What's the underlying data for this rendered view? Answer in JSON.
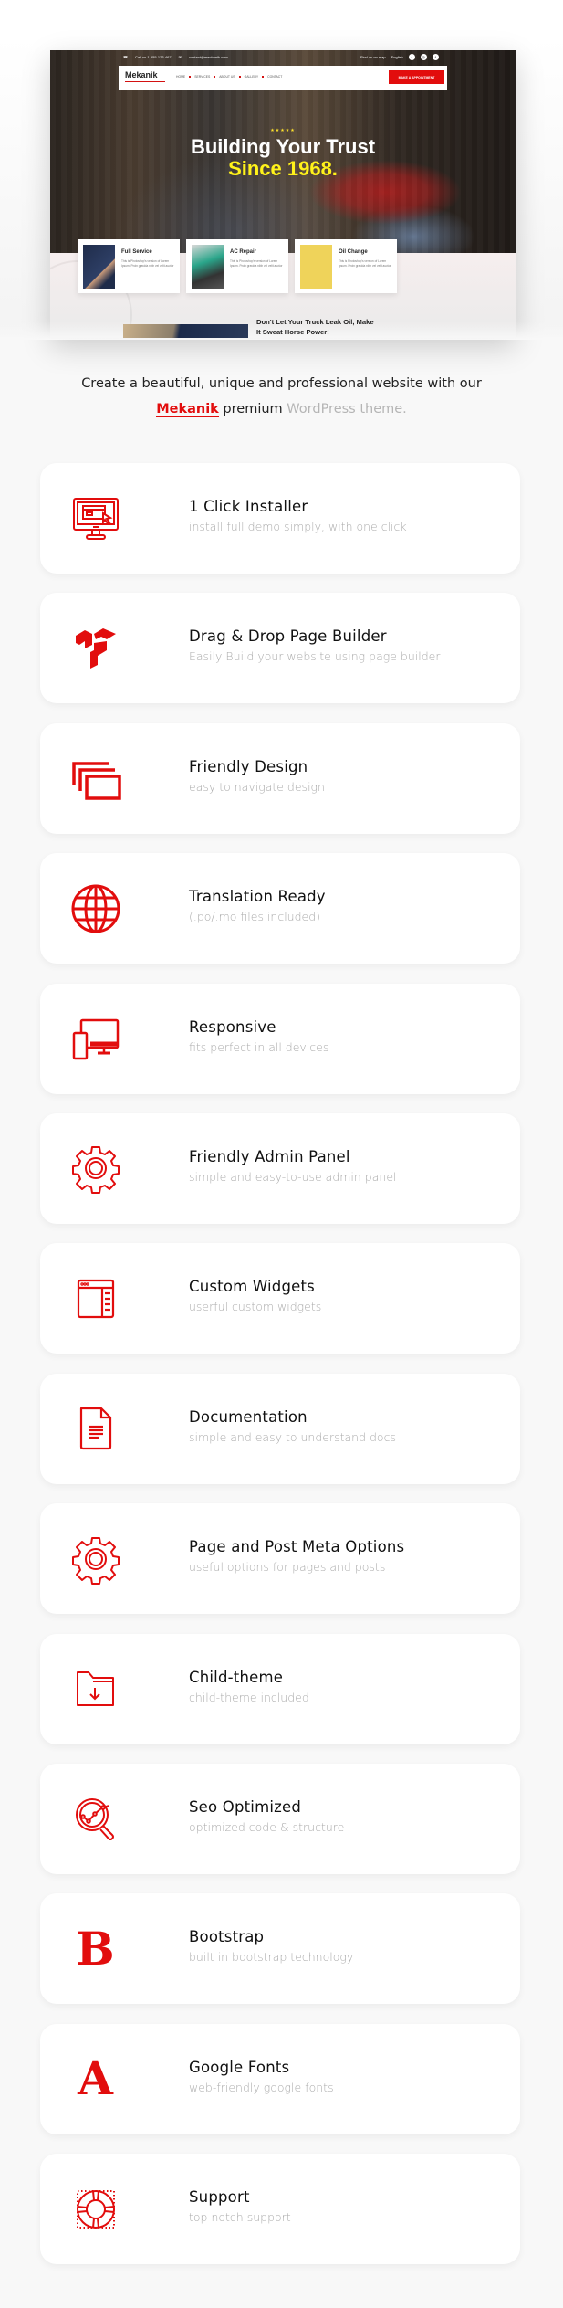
{
  "hero": {
    "topbar": {
      "phone": "Call us 1-555-123-467",
      "email": "contact@mechanik.com",
      "map_link": "Find us on map",
      "language": "English",
      "social": [
        "twitter-icon",
        "dribbble-icon",
        "facebook-icon"
      ]
    },
    "navbar": {
      "logo": "Mekanik",
      "links": [
        "HOME",
        "SERVICES",
        "ABOUT US",
        "GALLERY",
        "CONTACT"
      ],
      "cta": "MAKE A APPOINTMENT"
    },
    "stars": "★★★★★",
    "title": "Building Your Trust",
    "subtitle": "Since 1968.",
    "services": [
      {
        "title": "Full Service",
        "text": "This is Photoshop's version of Lorem Ipsum. Proin gravida nibh vel velit auctor"
      },
      {
        "title": "AC Repair",
        "text": "This is Photoshop's version of Lorem Ipsum. Proin gravida nibh vel velit auctor"
      },
      {
        "title": "Oil Change",
        "text": "This is Photoshop's version of Lorem Ipsum. Proin gravida nibh vel velit auctor"
      }
    ],
    "post_title": "Don't Let Your Truck Leak Oil, Make It Sweat Horse Power!"
  },
  "intro": {
    "line1": "Create a beautiful, unique and professional website with our",
    "brand": "Mekanik",
    "middle": " premium ",
    "tail": "WordPress theme."
  },
  "colors": {
    "accent": "#e20d0d",
    "title": "#111111",
    "muted": "#aaaaaa",
    "background": "#f8f8f8"
  },
  "features": [
    {
      "icon": "monitor-click-icon",
      "title": "1 Click Installer",
      "desc": "install full demo simply, with one click"
    },
    {
      "icon": "page-builder-icon",
      "title": "Drag & Drop Page Builder",
      "desc": "Easily Build your website using page builder"
    },
    {
      "icon": "stacked-windows-icon",
      "title": "Friendly Design",
      "desc": "easy to navigate design"
    },
    {
      "icon": "globe-icon",
      "title": "Translation Ready",
      "desc": "(.po/.mo files included)"
    },
    {
      "icon": "devices-icon",
      "title": "Responsive",
      "desc": "fits perfect in all devices"
    },
    {
      "icon": "gear-icon",
      "title": "Friendly Admin Panel",
      "desc": "simple and easy-to-use admin panel"
    },
    {
      "icon": "widget-window-icon",
      "title": "Custom Widgets",
      "desc": "userful custom widgets"
    },
    {
      "icon": "document-icon",
      "title": "Documentation",
      "desc": "simple and easy to understand docs"
    },
    {
      "icon": "gear-icon",
      "title": "Page and Post Meta Options",
      "desc": "useful options for pages and posts"
    },
    {
      "icon": "folder-download-icon",
      "title": "Child-theme",
      "desc": "child-theme included"
    },
    {
      "icon": "seo-magnifier-icon",
      "title": "Seo Optimized",
      "desc": "optimized code & structure"
    },
    {
      "icon": "bootstrap-icon",
      "title": "Bootstrap",
      "desc": "built in bootstrap technology",
      "glyph": "B"
    },
    {
      "icon": "google-fonts-icon",
      "title": "Google Fonts",
      "desc": "web-friendly google fonts",
      "glyph": "A"
    },
    {
      "icon": "lifebuoy-icon",
      "title": "Support",
      "desc": "top notch support"
    }
  ]
}
